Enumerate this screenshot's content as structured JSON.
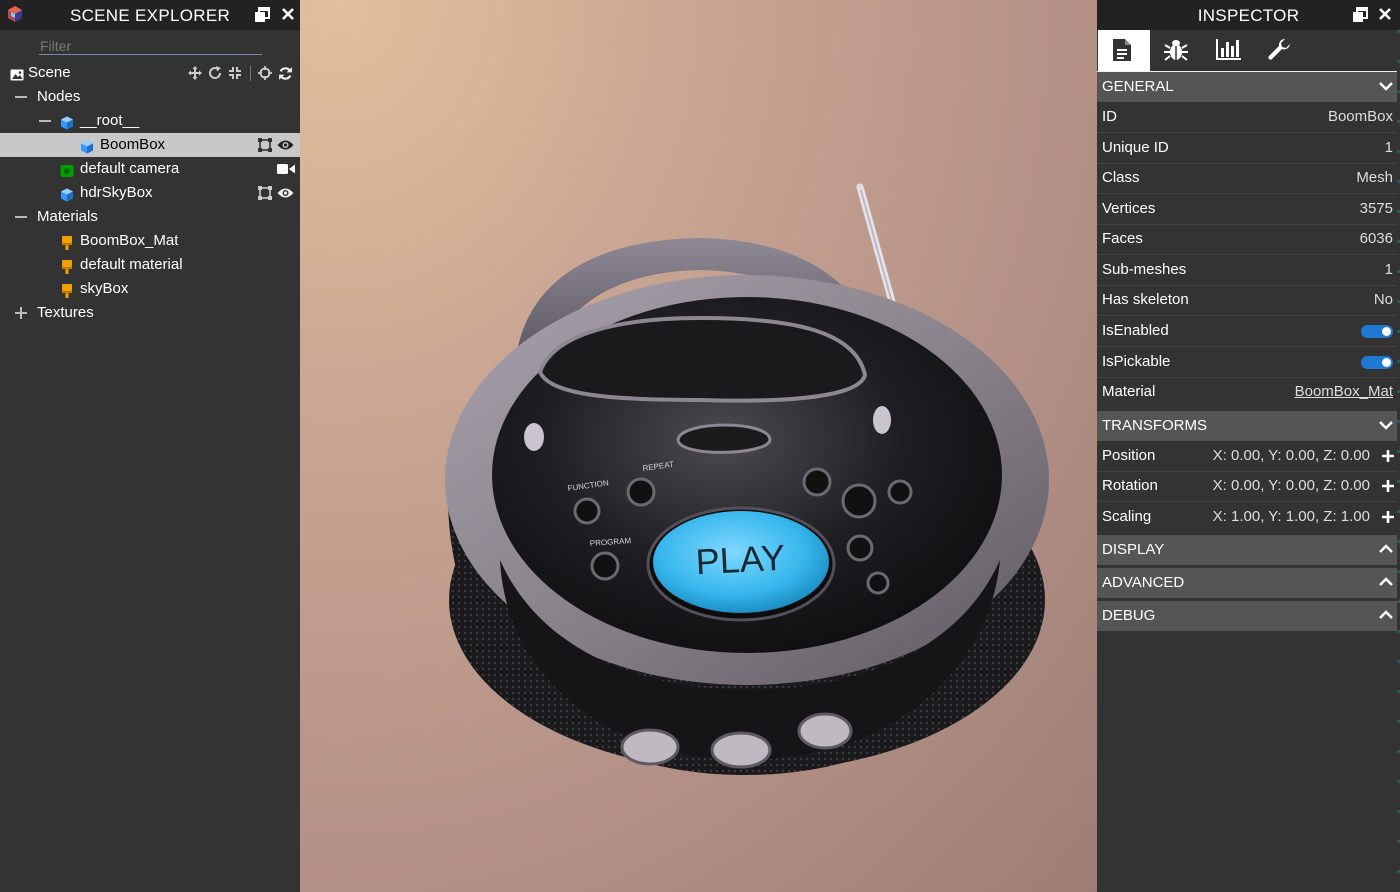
{
  "explorer": {
    "title": "SCENE EXPLORER",
    "filter_placeholder": "Filter",
    "scene_label": "Scene",
    "nodes_label": "Nodes",
    "root_label": "__root__",
    "boombox_label": "BoomBox",
    "camera_label": "default camera",
    "skybox_node_label": "hdrSkyBox",
    "materials_label": "Materials",
    "material_items": [
      "BoomBox_Mat",
      "default material",
      "skyBox"
    ],
    "textures_label": "Textures"
  },
  "viewport": {
    "model": "boombox",
    "button_text": "PLAY",
    "labels": [
      "REPEAT",
      "FUNCTION",
      "PROGRAM"
    ]
  },
  "inspector": {
    "title": "INSPECTOR",
    "tabs": [
      "properties-icon",
      "debug-icon",
      "statistics-icon",
      "tools-icon"
    ],
    "general": {
      "header": "GENERAL",
      "rows": [
        {
          "label": "ID",
          "value": "BoomBox"
        },
        {
          "label": "Unique ID",
          "value": "1"
        },
        {
          "label": "Class",
          "value": "Mesh"
        },
        {
          "label": "Vertices",
          "value": "3575"
        },
        {
          "label": "Faces",
          "value": "6036"
        },
        {
          "label": "Sub-meshes",
          "value": "1"
        },
        {
          "label": "Has skeleton",
          "value": "No"
        }
      ],
      "is_enabled_label": "IsEnabled",
      "is_enabled": true,
      "is_pickable_label": "IsPickable",
      "is_pickable": true,
      "material_label": "Material",
      "material_value": "BoomBox_Mat"
    },
    "transforms": {
      "header": "TRANSFORMS",
      "position_label": "Position",
      "position_value": "X: 0.00, Y: 0.00, Z: 0.00",
      "rotation_label": "Rotation",
      "rotation_value": "X: 0.00, Y: 0.00, Z: 0.00",
      "scaling_label": "Scaling",
      "scaling_value": "X: 1.00, Y: 1.00, Z: 1.00"
    },
    "display_header": "DISPLAY",
    "advanced_header": "ADVANCED",
    "debug_header": "DEBUG"
  },
  "colors": {
    "panel_bg": "#333333",
    "title_bg": "#222222",
    "section_bg": "#555555",
    "toggle_on": "#1f78d1",
    "selected_row": "#c8c8c8",
    "mesh_icon": "#3399ff",
    "material_icon": "#f0a000",
    "camera_icon": "#00a000"
  }
}
